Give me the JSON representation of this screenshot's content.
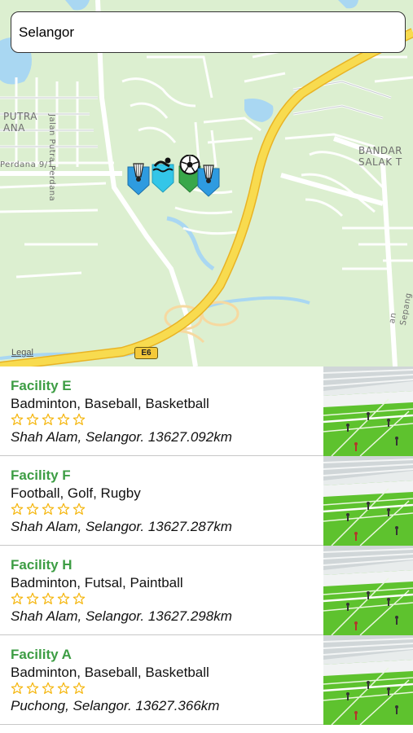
{
  "search": {
    "value": "Selangor",
    "placeholder": ""
  },
  "map": {
    "labels": {
      "putra_1": "PUTRA",
      "putra_2": "ANA",
      "perdana_road": "Perdana 9/1",
      "jalan_putra": "Jalan Putra Perdana",
      "bandar_1": "BANDAR",
      "bandar_2": "SALAK T",
      "sepang": "an Sepang",
      "legal": "Legal",
      "highway": "E6"
    },
    "pins": [
      {
        "icon": "badminton-shuttlecock-icon",
        "color": "#2e9be0"
      },
      {
        "icon": "swimmer-icon",
        "color": "#33c6e8"
      },
      {
        "icon": "soccer-ball-icon",
        "color": "#39a74a"
      },
      {
        "icon": "badminton-shuttlecock-icon",
        "color": "#2e9be0"
      }
    ]
  },
  "facilities": [
    {
      "name": "Facility E",
      "sports": "Badminton, Baseball, Basketball",
      "rating": 0,
      "location": "Shah Alam, Selangor. 13627.092km"
    },
    {
      "name": "Facility F",
      "sports": "Football, Golf, Rugby",
      "rating": 0,
      "location": "Shah Alam, Selangor. 13627.287km"
    },
    {
      "name": "Facility H",
      "sports": "Badminton, Futsal, Paintball",
      "rating": 0,
      "location": "Shah Alam, Selangor. 13627.298km"
    },
    {
      "name": "Facility A",
      "sports": "Badminton, Baseball, Basketball",
      "rating": 0,
      "location": "Puchong, Selangor. 13627.366km"
    }
  ],
  "colors": {
    "facility_name": "#3d9d44",
    "star": "#f5b50a",
    "map_bg": "#dcefd0",
    "highway": "#f6d13f"
  }
}
